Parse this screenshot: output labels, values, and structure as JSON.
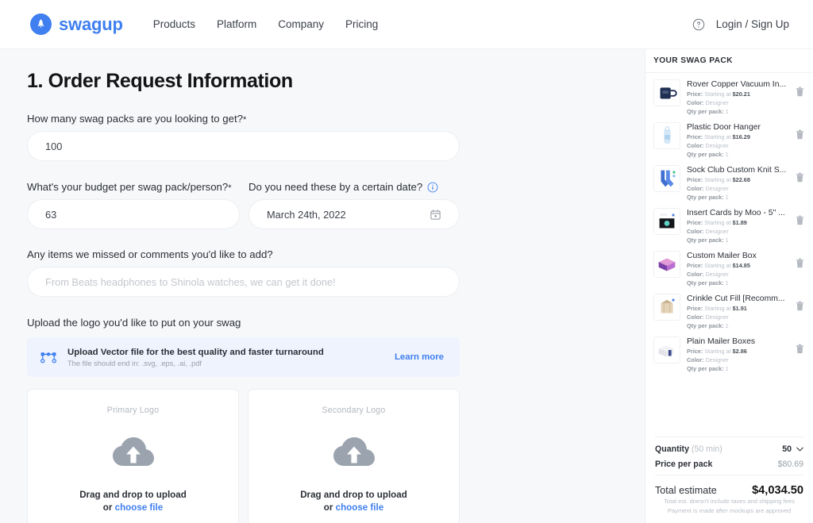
{
  "header": {
    "brand_name": "swagup",
    "logo_icon": "rocket-icon",
    "nav": [
      {
        "label": "Products"
      },
      {
        "label": "Platform"
      },
      {
        "label": "Company"
      },
      {
        "label": "Pricing"
      }
    ],
    "help_icon": "question-circle-icon",
    "login_label": "Login / Sign Up"
  },
  "form": {
    "title": "1. Order Request Information",
    "quantity": {
      "label": "How many swag packs are you looking to get?",
      "required_mark": "*",
      "value": "100"
    },
    "budget": {
      "label": "What's your budget per swag pack/person?",
      "required_mark": "*",
      "value": "63"
    },
    "date": {
      "label": "Do you need these by a certain date?",
      "info_icon": "info-circle-icon",
      "value": "March 24th, 2022",
      "calendar_icon": "calendar-icon"
    },
    "comments": {
      "label": "Any items we missed or comments you'd like to add?",
      "placeholder": "From Beats headphones to Shinola watches, we can get it done!",
      "value": ""
    },
    "upload": {
      "label": "Upload the logo you'd like to put on your swag",
      "banner": {
        "icon": "vector-path-icon",
        "title": "Upload Vector file for the best quality and faster turnaround",
        "subtitle": "The file should end in: .svg, .eps, .ai, .pdf",
        "link_label": "Learn more"
      },
      "dropzones": [
        {
          "title": "Primary Logo",
          "icon": "cloud-upload-icon",
          "cta": "Drag and drop to upload",
          "or_label": "or ",
          "choose_label": "choose file"
        },
        {
          "title": "Secondary Logo",
          "icon": "cloud-upload-icon",
          "cta": "Drag and drop to upload",
          "or_label": "or ",
          "choose_label": "choose file"
        }
      ]
    }
  },
  "sidebar": {
    "header": "YOUR SWAG PACK",
    "meta_labels": {
      "price": "Price:",
      "price_prefix": "Starting at",
      "color": "Color:",
      "qty": "Qty per pack:"
    },
    "delete_icon": "trash-icon",
    "items": [
      {
        "name": "Rover Copper Vacuum In...",
        "price": "$20.21",
        "color": "Designer",
        "qty": "1",
        "thumb": "navy-mug-thumb"
      },
      {
        "name": "Plastic Door Hanger",
        "price": "$16.29",
        "color": "Designer",
        "qty": "1",
        "thumb": "door-hanger-thumb"
      },
      {
        "name": "Sock Club Custom Knit S...",
        "price": "$22.68",
        "color": "Designer",
        "qty": "1",
        "thumb": "socks-thumb"
      },
      {
        "name": "Insert Cards by Moo - 5\" ...",
        "price": "$1.89",
        "color": "Designer",
        "qty": "1",
        "thumb": "insert-card-thumb"
      },
      {
        "name": "Custom Mailer Box",
        "price": "$14.85",
        "color": "Designer",
        "qty": "1",
        "thumb": "mailer-box-thumb"
      },
      {
        "name": "Crinkle Cut Fill [Recomm...",
        "price": "$1.91",
        "color": "Designer",
        "qty": "1",
        "thumb": "crinkle-fill-thumb"
      },
      {
        "name": "Plain Mailer Boxes",
        "price": "$2.86",
        "color": "Designer",
        "qty": "1",
        "thumb": "plain-box-thumb"
      }
    ],
    "summary": {
      "quantity_label": "Quantity",
      "quantity_hint": "(50 min)",
      "quantity_value": "50",
      "quantity_chevron": "chevron-down-icon",
      "price_per_pack_label": "Price per pack",
      "price_per_pack_value": "$80.69",
      "total_label": "Total estimate",
      "total_value": "$4,034.50"
    },
    "footer_line1": "Total est. doesn't include taxes and shipping fees",
    "footer_line2": "Payment is made after mockups are approved"
  },
  "colors": {
    "brand_blue": "#3f7ff0",
    "banner_bg": "#eef3fd",
    "page_bg": "#f7f8fa"
  }
}
